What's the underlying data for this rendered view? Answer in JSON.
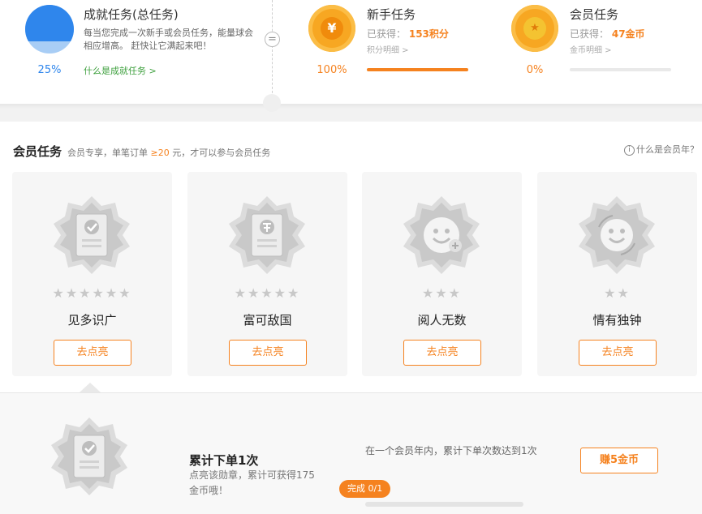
{
  "summary": {
    "achievement": {
      "title": "成就任务(总任务)",
      "desc": "每当您完成一次新手或会员任务，能量球会相应增高。 赶快让它满起来吧！",
      "link": "什么是成就任务 >",
      "percent_text": "25%",
      "percent": 0.25
    },
    "equals_symbol": "=",
    "newbie": {
      "title": "新手任务",
      "earned_label": "已获得：",
      "earned_value": "153积分",
      "detail_link": "积分明细 >",
      "percent_text": "100%",
      "percent": 1.0,
      "icon_symbol": "¥"
    },
    "member": {
      "title": "会员任务",
      "earned_label": "已获得：",
      "earned_value": "47金币",
      "detail_link": "金币明细 >",
      "percent_text": "0%",
      "percent": 0.0,
      "icon_symbol": "★"
    }
  },
  "member_section": {
    "title": "会员任务",
    "note_prefix": "会员专享，单笔订单",
    "note_highlight": "≥20",
    "note_suffix": "元，才可以参与会员任务",
    "help_icon": "i",
    "help_text": "什么是会员年？",
    "cards": [
      {
        "name": "见多识广",
        "stars": "★★★★★★",
        "button": "去点亮",
        "icon": "check-certificate"
      },
      {
        "name": "富可敌国",
        "stars": "★★★★★",
        "button": "去点亮",
        "icon": "yuan-certificate"
      },
      {
        "name": "阅人无数",
        "stars": "★★★",
        "button": "去点亮",
        "icon": "smile-plus"
      },
      {
        "name": "情有独钟",
        "stars": "★★",
        "button": "去点亮",
        "icon": "smile-refresh"
      }
    ]
  },
  "detail": {
    "title": "累计下单1次",
    "desc": "点亮该勋章，累计可获得175金币哦！",
    "condition": "在一个会员年内，累计下单次数达到1次",
    "earn_button": "赚5金币",
    "progress_text": "完成 0/1",
    "progress": 0.0
  },
  "colors": {
    "accent_orange": "#f5821f",
    "accent_blue": "#2f86ec",
    "link_green": "#3ea03e"
  }
}
